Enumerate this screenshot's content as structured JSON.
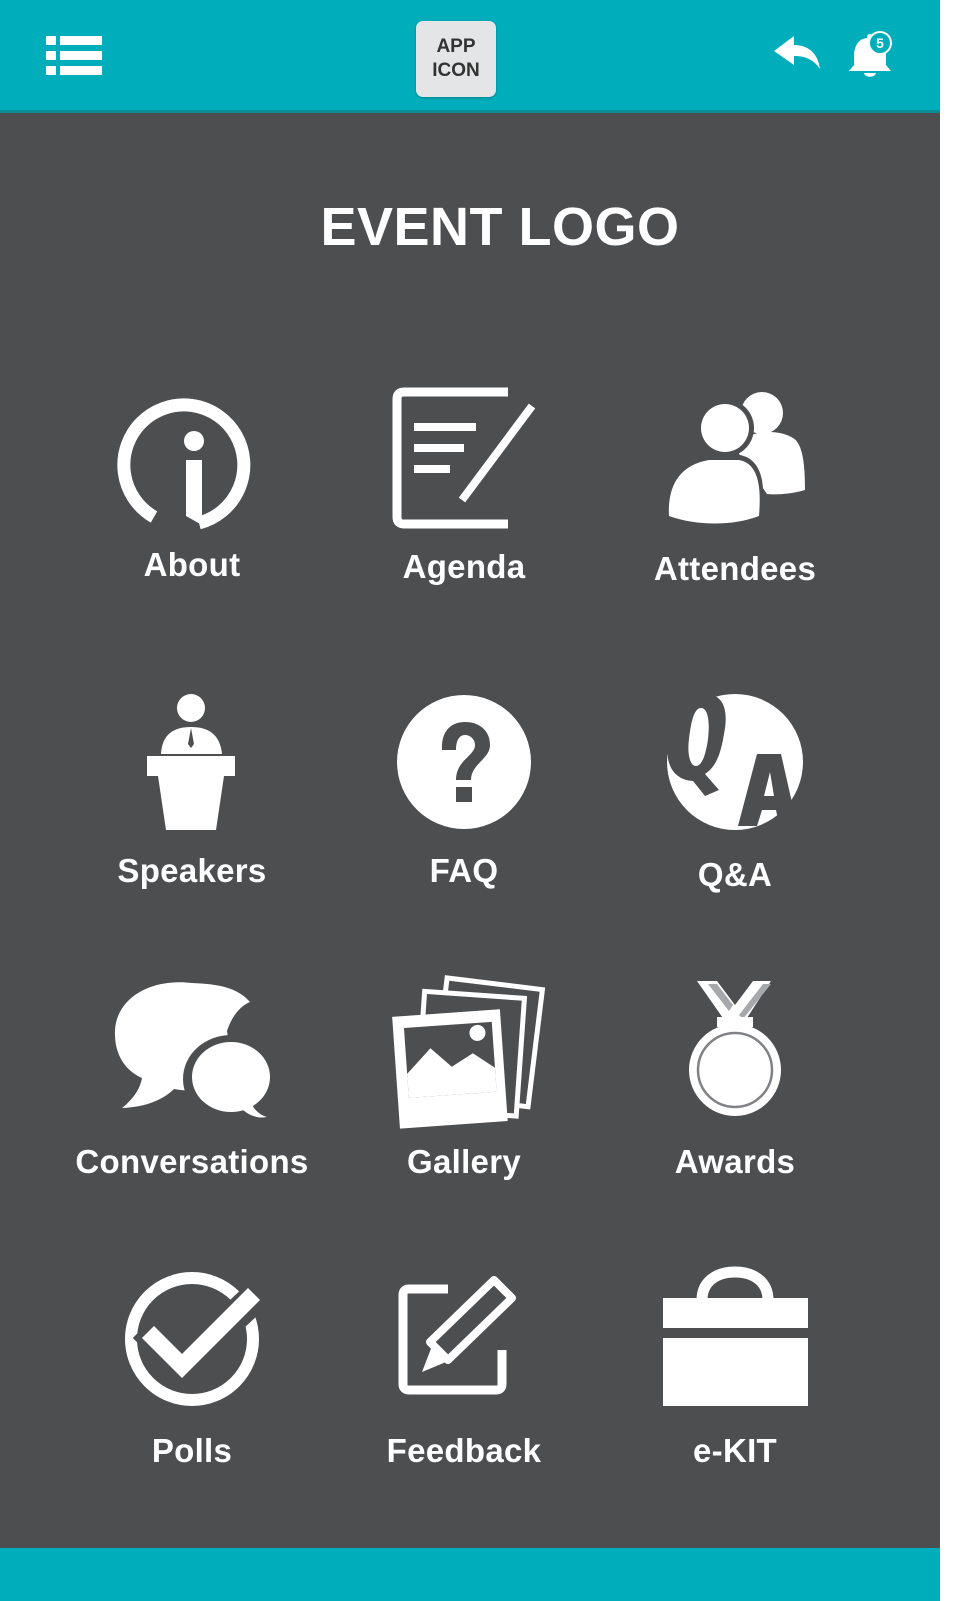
{
  "header": {
    "app_icon_text": "APP\nICON",
    "notification_count": "5",
    "menu_icon": "list-menu-icon",
    "back_icon": "reply-arrow-icon",
    "bell_icon": "bell-icon"
  },
  "event_logo": "EVENT LOGO",
  "colors": {
    "accent": "#00adbb",
    "background": "#4d4e50",
    "foreground": "#ffffff"
  },
  "tiles": [
    {
      "label": "About",
      "icon": "info-icon"
    },
    {
      "label": "Agenda",
      "icon": "agenda-note-icon"
    },
    {
      "label": "Attendees",
      "icon": "people-icon"
    },
    {
      "label": "Speakers",
      "icon": "podium-speaker-icon"
    },
    {
      "label": "FAQ",
      "icon": "question-icon"
    },
    {
      "label": "Q&A",
      "icon": "qa-icon"
    },
    {
      "label": "Conversations",
      "icon": "chat-bubbles-icon"
    },
    {
      "label": "Gallery",
      "icon": "photo-gallery-icon"
    },
    {
      "label": "Awards",
      "icon": "medal-icon"
    },
    {
      "label": "Polls",
      "icon": "checkmark-circle-icon"
    },
    {
      "label": "Feedback",
      "icon": "edit-pencil-icon"
    },
    {
      "label": "e-KIT",
      "icon": "briefcase-icon"
    }
  ]
}
